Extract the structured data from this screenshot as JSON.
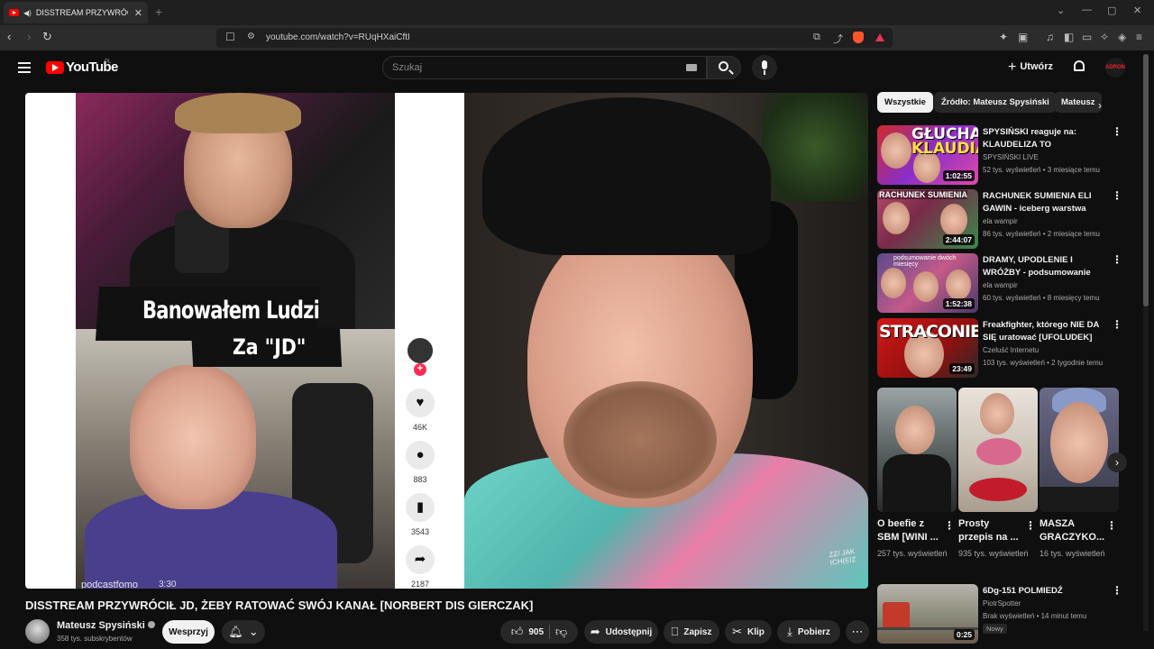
{
  "browser": {
    "tab_title": "DISSTREAM PRZYWRÓCIŁ JD",
    "url": "youtube.com/watch?v=RUqHXaiCftI"
  },
  "header": {
    "logo_text": "YouTube",
    "logo_country": "PL",
    "search_placeholder": "Szukaj",
    "create_label": "Utwórz",
    "avatar_text": "ADRON"
  },
  "player": {
    "caption_line1": "Banowałem Ludzi",
    "caption_line2": "Za \"JD\"",
    "handle": "podcastfomo",
    "handle_time": "3:30",
    "likes": "46K",
    "comments": "883",
    "saves": "3543",
    "shares": "2187",
    "watermark": "ZZ/ JAK ICH(E/Z"
  },
  "video": {
    "title": "DISSTREAM PRZYWRÓCIŁ JD, ŻEBY RATOWAĆ SWÓJ KANAŁ [NORBERT DIS GIERCZAK]",
    "channel": "Mateusz Spysiński",
    "subscribers": "358 tys. subskrybentów",
    "support_label": "Wesprzyj",
    "like_count": "905",
    "share_label": "Udostępnij",
    "save_label": "Zapisz",
    "clip_label": "Klip",
    "download_label": "Pobierz"
  },
  "chips": [
    "Wszystkie",
    "Źródło: Mateusz Spysiński",
    "Mateusz"
  ],
  "recommendations": [
    {
      "title": "SPYSIŃSKI reaguje na: KLAUDELIZA TO NAJGŁUPSZ...",
      "channel": "SPYSIŃSKI LIVE",
      "meta": "52 tys. wyświetleń • 3 miesiące temu",
      "duration": "1:02:55",
      "thumb_text1": "GŁUCHA",
      "thumb_text2": "KLAUDIA"
    },
    {
      "title": "RACHUNEK SUMIENIA ELI GAWIN - iceberg warstwa druga",
      "channel": "ela wampir",
      "meta": "86 tys. wyświetleń • 2 miesiące temu",
      "duration": "2:44:07",
      "thumb_text1": "RACHUNEK SUMIENIA"
    },
    {
      "title": "DRAMY, UPODLENIE I WRÓŻBY - podsumowanie dwóch ...",
      "channel": "ela wampir",
      "meta": "60 tys. wyświetleń • 8 miesięcy temu",
      "duration": "1:52:38",
      "thumb_text1": "podsumowanie dwóch miesięcy"
    },
    {
      "title": "Freakfighter, którego NIE DA SIĘ uratować [UFOLUDEK]",
      "channel": "Czeluść Internetu",
      "meta": "103 tys. wyświetleń • 2 tygodnie temu",
      "duration": "23:49",
      "thumb_text1": "STRACONIEC"
    }
  ],
  "shorts": [
    {
      "title": "O beefie z SBM [WINI ...",
      "views": "257 tys. wyświetleń"
    },
    {
      "title": "Prosty przepis na ...",
      "views": "935 tys. wyświetleń"
    },
    {
      "title": "MASZA GRACZYKO...",
      "views": "16 tys. wyświetleń"
    }
  ],
  "rec_bottom": {
    "title": "6Dg-151 POLMIEDŹ",
    "channel": "PiotrSpotter",
    "meta": "Brak wyświetleń • 14 minut temu",
    "badge": "Nowy",
    "duration": "0:25"
  },
  "icons": {
    "like": "thumb-up-icon",
    "dislike": "thumb-down-icon",
    "share": "share-arrow-icon",
    "save": "bookmark-icon",
    "clip": "scissors-icon",
    "download": "download-icon",
    "more": "more-horizontal-icon"
  },
  "colors": {
    "brand_red": "#ff0000",
    "background": "#0f0f0f",
    "pill_bg": "#272727"
  }
}
